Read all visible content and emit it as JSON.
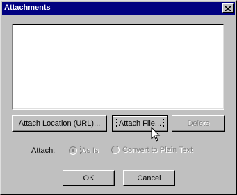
{
  "dialog": {
    "title": "Attachments"
  },
  "buttons": {
    "attach_location": "Attach Location (URL)...",
    "attach_file": "Attach File...",
    "delete": "Delete",
    "ok": "OK",
    "cancel": "Cancel"
  },
  "attach_options": {
    "label": "Attach:",
    "as_is": "As Is",
    "convert": "Convert to Plain Text",
    "selected": "As Is",
    "enabled": false
  },
  "attachments_list": {
    "items": []
  },
  "colors": {
    "titlebar": "#000080",
    "face": "#c0c0c0",
    "disabled_text": "#808080"
  },
  "icons": {
    "close": "close-icon",
    "cursor": "mouse-pointer-icon"
  }
}
